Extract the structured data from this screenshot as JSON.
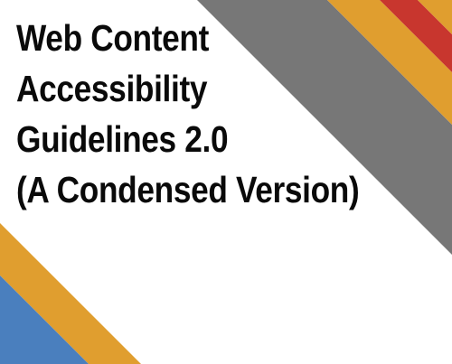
{
  "cover": {
    "title_lines": [
      "Web Content",
      "Accessibility",
      "Guidelines 2.0",
      "(A Condensed Version)"
    ]
  },
  "colors": {
    "background": "#ffffff",
    "stripe_gray": "#777777",
    "stripe_orange": "#e09e2f",
    "stripe_red": "#c8362e",
    "stripe_blue": "#4a7fbe",
    "title_text": "#0a0a0a"
  }
}
